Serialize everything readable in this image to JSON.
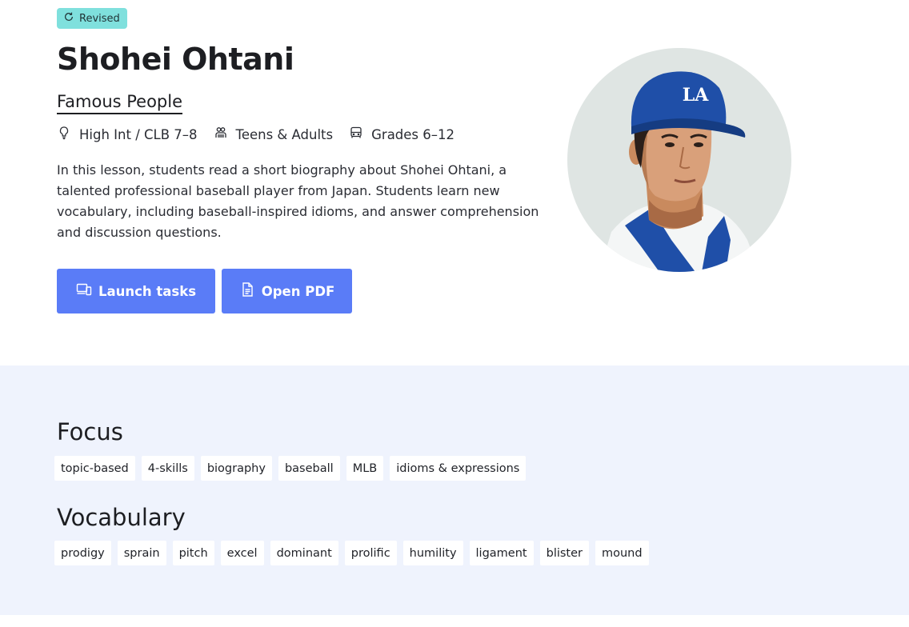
{
  "badge": {
    "icon": "refresh-icon",
    "label": "Revised"
  },
  "lesson": {
    "title": "Shohei Ohtani",
    "category": "Famous People",
    "meta": [
      {
        "icon": "lightbulb-icon",
        "label": "High Int / CLB 7–8"
      },
      {
        "icon": "people-icon",
        "label": "Teens & Adults"
      },
      {
        "icon": "bus-icon",
        "label": "Grades 6–12"
      }
    ],
    "description": "In this lesson, students read a short biography about Shohei Ohtani, a talented professional baseball player from Japan. Students learn new vocabulary, including baseball-inspired idioms, and answer comprehension and discussion questions."
  },
  "actions": {
    "launch_label": "Launch tasks",
    "pdf_label": "Open PDF"
  },
  "portrait": {
    "cap_logo": "LA"
  },
  "focus": {
    "title": "Focus",
    "tags": [
      "topic-based",
      "4-skills",
      "biography",
      "baseball",
      "MLB",
      "idioms & expressions"
    ]
  },
  "vocabulary": {
    "title": "Vocabulary",
    "tags": [
      "prodigy",
      "sprain",
      "pitch",
      "excel",
      "dominant",
      "prolific",
      "humility",
      "ligament",
      "blister",
      "mound"
    ]
  },
  "colors": {
    "accent": "#5a7cf7",
    "badge": "#7fe0dd",
    "section_bg": "#eff3fd"
  }
}
